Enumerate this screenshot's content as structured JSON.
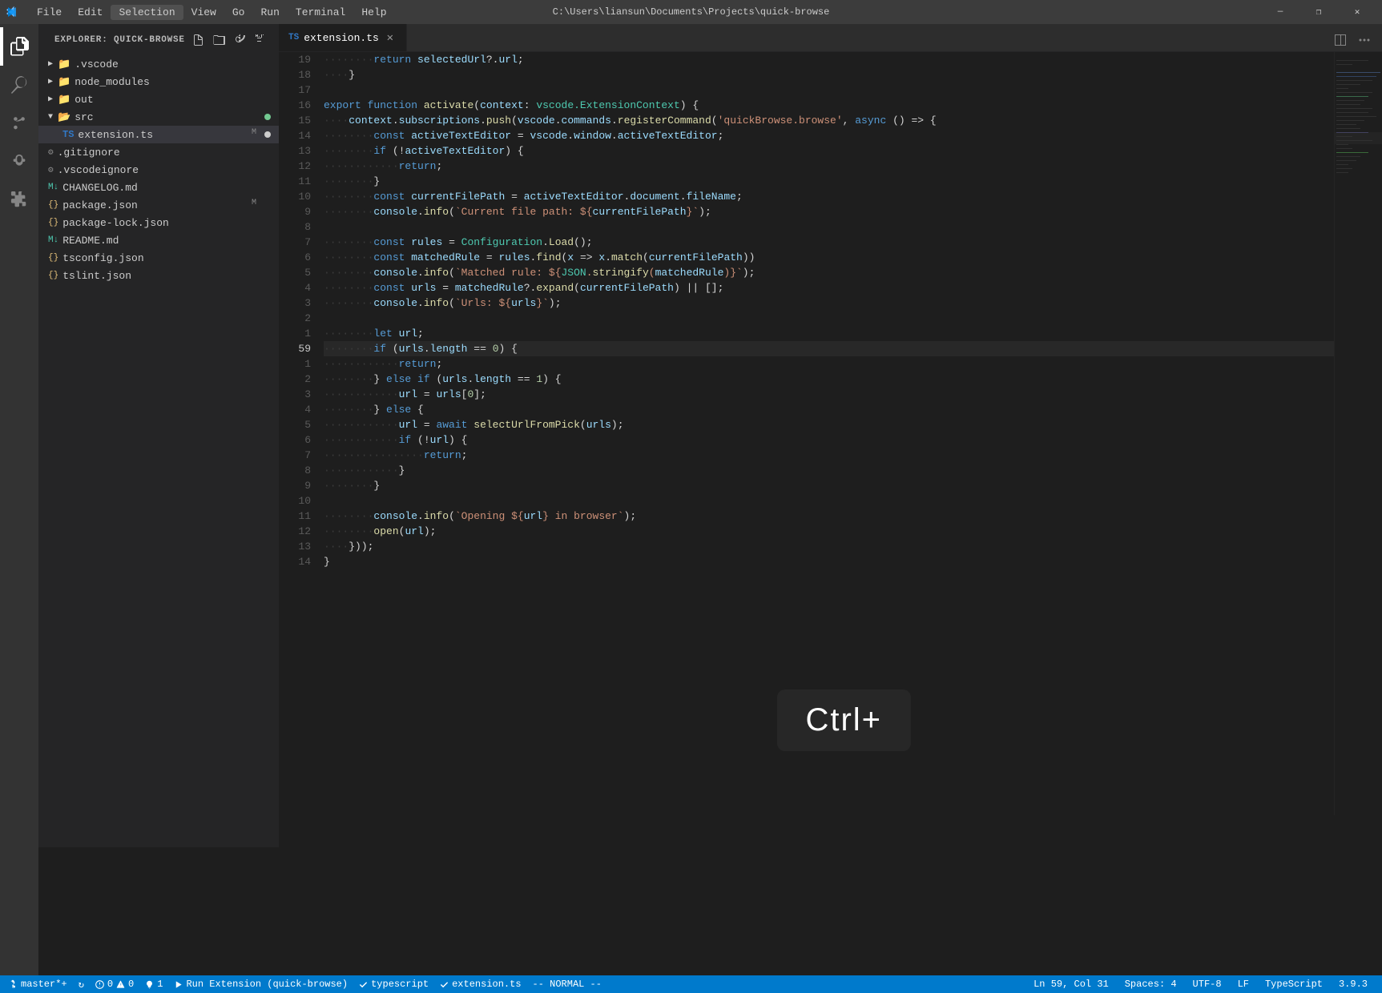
{
  "titlebar": {
    "icon": "⬡",
    "menu_items": [
      "File",
      "Edit",
      "Selection",
      "View",
      "Go",
      "Run",
      "Terminal",
      "Help"
    ],
    "active_menu": "Selection",
    "title": "C:\\Users\\liansun\\Documents\\Projects\\quick-browse",
    "controls": [
      "—",
      "❐",
      "✕"
    ]
  },
  "activity_bar": {
    "icons": [
      "files",
      "search",
      "source-control",
      "debug",
      "extensions"
    ]
  },
  "sidebar": {
    "title": "EXPLORER: QUICK-BROWSE",
    "tree": [
      {
        "indent": 0,
        "type": "folder",
        "open": true,
        "label": ".vscode",
        "dirty": false,
        "modified": false
      },
      {
        "indent": 0,
        "type": "folder",
        "open": false,
        "label": "node_modules",
        "dirty": false,
        "modified": false
      },
      {
        "indent": 0,
        "type": "folder",
        "open": false,
        "label": "out",
        "dirty": false,
        "modified": false
      },
      {
        "indent": 0,
        "type": "folder",
        "open": true,
        "label": "src",
        "dirty": true,
        "modified": false
      },
      {
        "indent": 1,
        "type": "ts",
        "label": "extension.ts",
        "dirty": false,
        "modified": true
      },
      {
        "indent": 0,
        "type": "git",
        "label": ".gitignore",
        "dirty": false,
        "modified": false
      },
      {
        "indent": 0,
        "type": "git",
        "label": ".vscodeignore",
        "dirty": false,
        "modified": false
      },
      {
        "indent": 0,
        "type": "md",
        "label": "CHANGELOG.md",
        "dirty": false,
        "modified": false
      },
      {
        "indent": 0,
        "type": "json",
        "label": "package.json",
        "dirty": false,
        "modified": true
      },
      {
        "indent": 0,
        "type": "json",
        "label": "package-lock.json",
        "dirty": false,
        "modified": false
      },
      {
        "indent": 0,
        "type": "md",
        "label": "README.md",
        "dirty": false,
        "modified": false
      },
      {
        "indent": 0,
        "type": "json",
        "label": "tsconfig.json",
        "dirty": false,
        "modified": false
      },
      {
        "indent": 0,
        "type": "json",
        "label": "tslint.json",
        "dirty": false,
        "modified": false
      }
    ]
  },
  "tabs": [
    {
      "label": "extension.ts",
      "type": "ts",
      "active": true,
      "dirty": false
    }
  ],
  "code": {
    "lines": [
      {
        "num": 19,
        "content": "        return selectedUrl?.url;"
      },
      {
        "num": 18,
        "content": "    }"
      },
      {
        "num": 17,
        "content": ""
      },
      {
        "num": 16,
        "content": "export function activate(context: vscode.ExtensionContext) {"
      },
      {
        "num": 15,
        "content": "    context.subscriptions.push(vscode.commands.registerCommand('quickBrowse.browse', async () => {"
      },
      {
        "num": 14,
        "content": "        const activeTextEditor = vscode.window.activeTextEditor;"
      },
      {
        "num": 13,
        "content": "        if (!activeTextEditor) {"
      },
      {
        "num": 12,
        "content": "            return;"
      },
      {
        "num": 11,
        "content": "        }"
      },
      {
        "num": 10,
        "content": "        const currentFilePath = activeTextEditor.document.fileName;"
      },
      {
        "num": 9,
        "content": "        console.info(`Current file path: ${currentFilePath}`);"
      },
      {
        "num": 8,
        "content": ""
      },
      {
        "num": 7,
        "content": "        const rules = Configuration.Load();"
      },
      {
        "num": 6,
        "content": "        const matchedRule = rules.find(x => x.match(currentFilePath))"
      },
      {
        "num": 5,
        "content": "        console.info(`Matched rule: ${JSON.stringify(matchedRule)}`);"
      },
      {
        "num": 4,
        "content": "        const urls = matchedRule?.expand(currentFilePath) || [];"
      },
      {
        "num": 3,
        "content": "        console.info(`Urls: ${urls}`);"
      },
      {
        "num": 2,
        "content": ""
      },
      {
        "num": 1,
        "content": "        let url;"
      },
      {
        "num": 59,
        "content": "        if (urls.length == 0) {"
      },
      {
        "num": 1,
        "content": "            return;"
      },
      {
        "num": 2,
        "content": "        } else if (urls.length == 1) {"
      },
      {
        "num": 3,
        "content": "            url = urls[0];"
      },
      {
        "num": 4,
        "content": "        } else {"
      },
      {
        "num": 5,
        "content": "            url = await selectUrlFromPick(urls);"
      },
      {
        "num": 6,
        "content": "            if (!url) {"
      },
      {
        "num": 7,
        "content": "                return;"
      },
      {
        "num": 8,
        "content": "            }"
      },
      {
        "num": 9,
        "content": "        }"
      },
      {
        "num": 10,
        "content": ""
      },
      {
        "num": 11,
        "content": "        console.info(`Opening ${url} in browser`);"
      },
      {
        "num": 12,
        "content": "        open(url);"
      },
      {
        "num": 13,
        "content": "    }));"
      },
      {
        "num": 14,
        "content": "}"
      }
    ]
  },
  "ctrl_overlay": {
    "text": "Ctrl+"
  },
  "statusbar": {
    "branch": "master*+",
    "sync": "↻",
    "errors": "0",
    "warnings": "0",
    "lightbulb": "1",
    "run_label": "Run Extension (quick-browse)",
    "typescript": "typescript",
    "file": "extension.ts",
    "mode": "-- NORMAL --",
    "position": "Ln 59, Col 31",
    "spaces": "Spaces: 4",
    "encoding": "UTF-8",
    "eol": "LF",
    "language": "TypeScript",
    "version": "3.9.3"
  }
}
